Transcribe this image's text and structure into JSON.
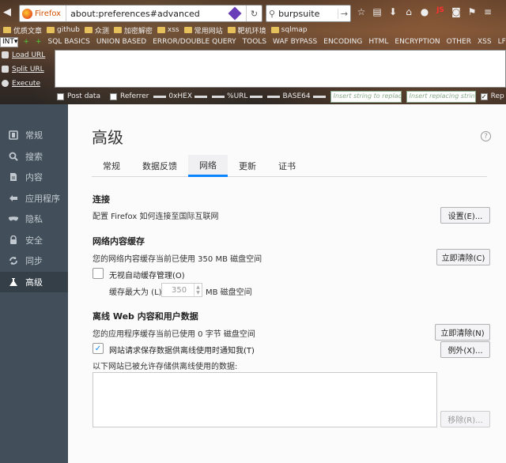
{
  "browser": {
    "brand": "Firefox",
    "url": "about:preferences#advanced",
    "search": "burpsuite"
  },
  "bookmarks": [
    "优质文章",
    "github",
    "众测",
    "加密解密",
    "xss",
    "常用网站",
    "靶机环境",
    "sqlmap"
  ],
  "hackbar": {
    "select_value": "INT",
    "menu": [
      "SQL BASICS",
      "UNION BASED",
      "ERROR/DOUBLE QUERY",
      "TOOLS",
      "WAF BYPASS",
      "ENCODING",
      "HTML",
      "ENCRYPTION",
      "OTHER",
      "XSS",
      "LFI"
    ],
    "actions": [
      "Load URL",
      "Split URL",
      "Execute"
    ],
    "options": {
      "post_data": "Post data",
      "referrer": "Referrer",
      "hex": "0xHEX",
      "url": "%URL",
      "base64": "BASE64",
      "insert_placeholder": "Insert string to replace",
      "replacing_placeholder": "Insert replacing string",
      "rep": "Rep"
    }
  },
  "sidebar": {
    "items": [
      {
        "label": "常规",
        "icon": "general-icon"
      },
      {
        "label": "搜索",
        "icon": "search-icon"
      },
      {
        "label": "内容",
        "icon": "content-icon"
      },
      {
        "label": "应用程序",
        "icon": "applications-icon"
      },
      {
        "label": "隐私",
        "icon": "privacy-mask-icon"
      },
      {
        "label": "安全",
        "icon": "lock-icon"
      },
      {
        "label": "同步",
        "icon": "sync-icon"
      },
      {
        "label": "高级",
        "icon": "advanced-icon",
        "active": true
      }
    ]
  },
  "main": {
    "title": "高级",
    "tabs": [
      "常规",
      "数据反馈",
      "网络",
      "更新",
      "证书"
    ],
    "active_tab": "网络",
    "connection": {
      "heading": "连接",
      "desc": "配置 Firefox 如何连接至国际互联网",
      "button": "设置(E)..."
    },
    "cache": {
      "heading": "网络内容缓存",
      "desc": "您的网络内容缓存当前已使用 350 MB 磁盘空间",
      "clear_button": "立即清除(C)",
      "override_label": "无视自动缓存管理(O)",
      "limit_label": "缓存最大为 (L)",
      "limit_value": "350",
      "limit_unit": "MB 磁盘空间"
    },
    "offline": {
      "heading": "离线 Web 内容和用户数据",
      "desc": "您的应用程序缓存当前已使用 0 字节 磁盘空间",
      "clear_button": "立即清除(N)",
      "notify_label": "网站请求保存数据供离线使用时通知我(T)",
      "exceptions_button": "例外(X)...",
      "list_label": "以下网站已被允许存储供离线使用的数据:",
      "remove_button": "移除(R)..."
    }
  },
  "colors": {
    "sidebar_bg": "#424f5a",
    "accent": "#0a84ff"
  }
}
